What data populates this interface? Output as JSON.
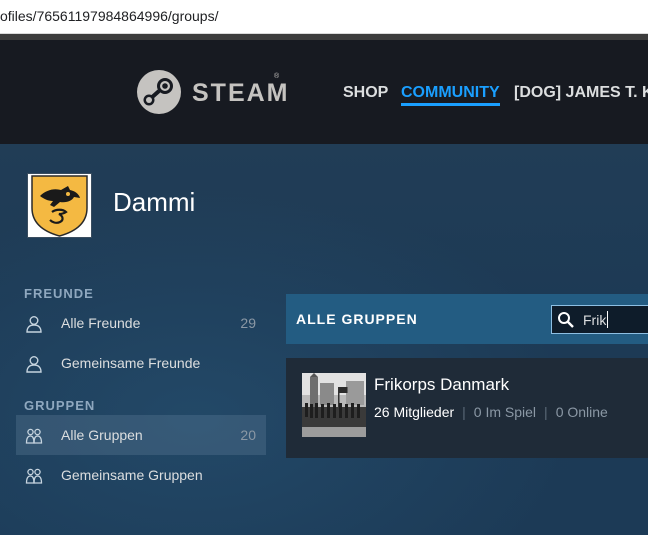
{
  "browser": {
    "url": "ofiles/76561197984864996/groups/"
  },
  "header": {
    "logo_text": "STEAM",
    "logo_tm": "®",
    "nav": [
      {
        "label": "SHOP",
        "active": false
      },
      {
        "label": "COMMUNITY",
        "active": true
      },
      {
        "label": "[DOG] JAMES T. K",
        "active": false
      }
    ],
    "accent": "#1a9fff"
  },
  "profile": {
    "name": "Dammi",
    "avatar_icon": "coat-of-arms-avatar"
  },
  "sidebar": {
    "friends_heading": "FREUNDE",
    "friends_items": [
      {
        "label": "Alle Freunde",
        "count": "29",
        "icon": "person-icon"
      },
      {
        "label": "Gemeinsame Freunde",
        "count": "",
        "icon": "person-icon"
      }
    ],
    "groups_heading": "GRUPPEN",
    "groups_items": [
      {
        "label": "Alle Gruppen",
        "count": "20",
        "icon": "group-icon",
        "selected": true
      },
      {
        "label": "Gemeinsame Gruppen",
        "count": "",
        "icon": "group-icon"
      }
    ]
  },
  "groups_panel": {
    "title": "ALLE GRUPPEN",
    "search": {
      "value": "Frik",
      "icon": "search-icon"
    }
  },
  "groups": [
    {
      "name": "Frikorps Danmark",
      "members": "26 Mitglieder",
      "in_game": "0 Im Spiel",
      "online": "0 Online"
    }
  ]
}
